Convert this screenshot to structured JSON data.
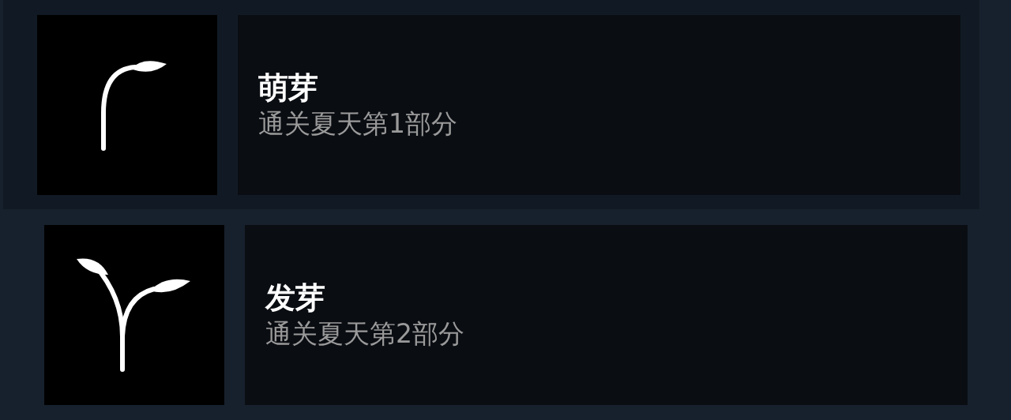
{
  "achievements": [
    {
      "kind": "single",
      "title": "萌芽",
      "description": "通关夏天第1部分"
    },
    {
      "kind": "double",
      "title": "发芽",
      "description": "通关夏天第2部分"
    }
  ]
}
